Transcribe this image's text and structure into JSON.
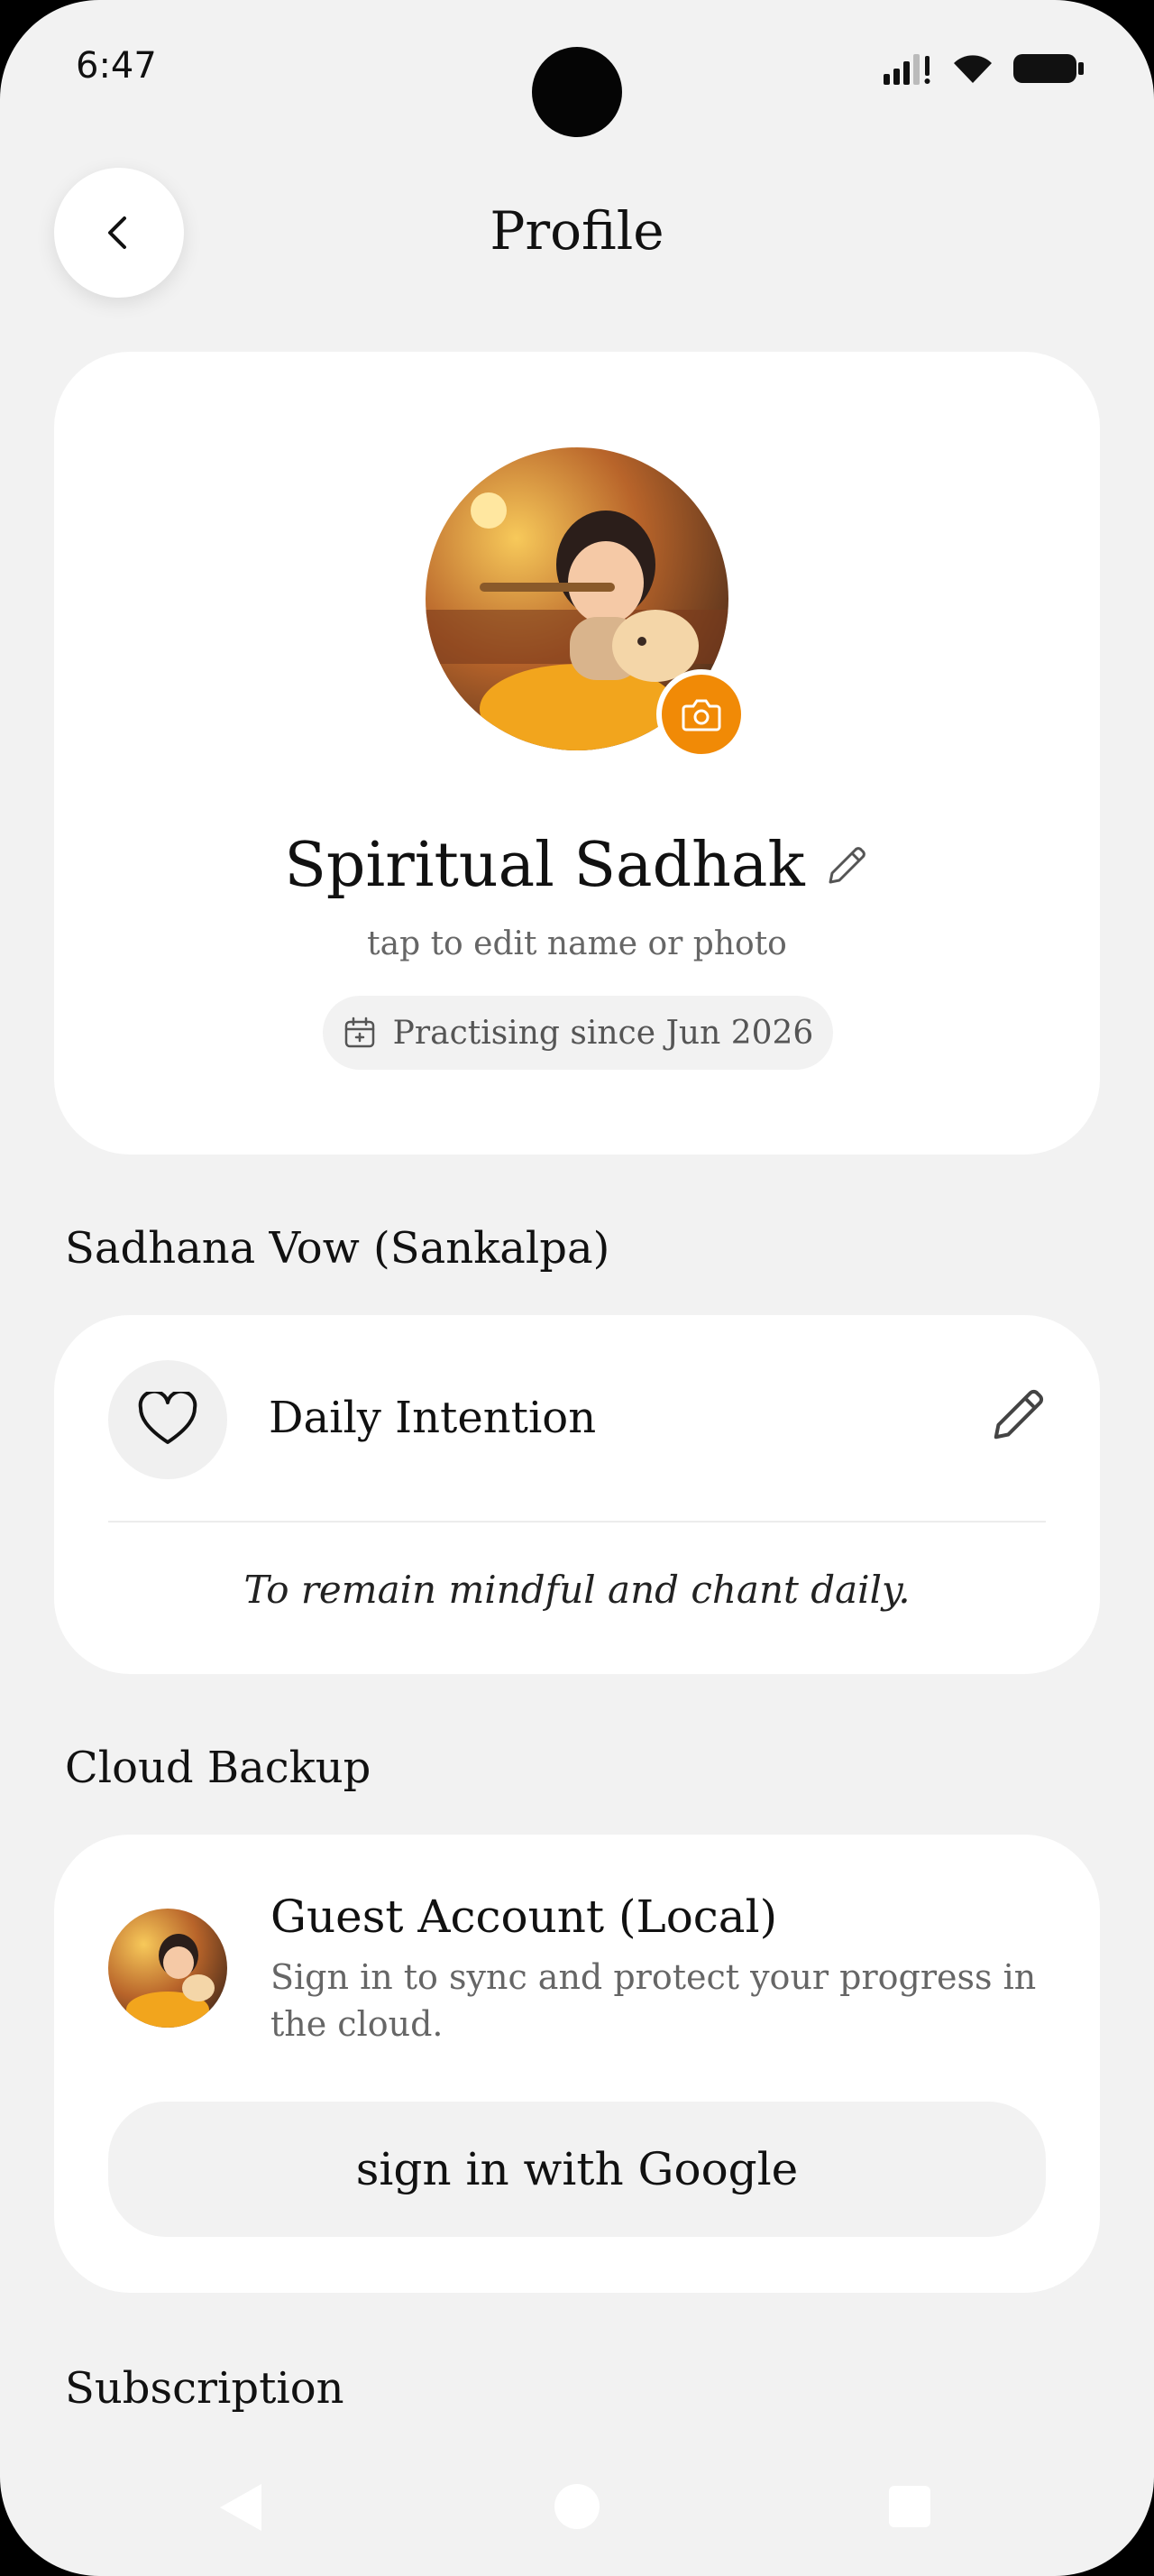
{
  "status_bar": {
    "time": "6:47"
  },
  "header": {
    "title": "Profile"
  },
  "profile": {
    "name": "Spiritual Sadhak",
    "hint": "tap to edit name or photo",
    "since": "Practising since Jun 2026"
  },
  "vow_section": {
    "title": "Sadhana Vow (Sankalpa)",
    "label": "Daily Intention",
    "intention": "To remain mindful and chant daily."
  },
  "backup_section": {
    "title": "Cloud Backup",
    "account_title": "Guest Account (Local)",
    "account_subtitle": "Sign in to sync and protect your progress in the cloud.",
    "google_button": "sign in with Google"
  },
  "subscription_section": {
    "title": "Subscription"
  },
  "colors": {
    "accent": "#f18a06",
    "background": "#f2f2f2",
    "card": "#ffffff"
  },
  "icons": [
    "back-arrow-icon",
    "camera-icon",
    "pencil-icon",
    "calendar-icon",
    "heart-icon",
    "wifi-icon",
    "signal-icon",
    "battery-icon"
  ]
}
